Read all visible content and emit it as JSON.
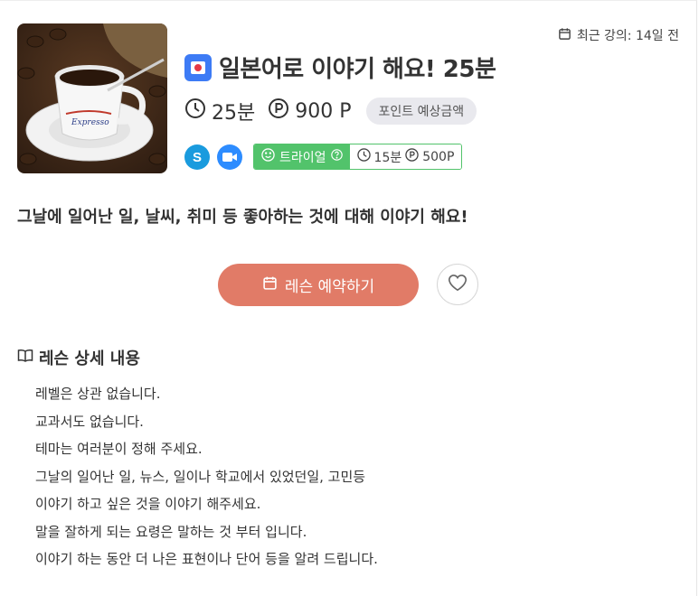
{
  "recent": {
    "label": "최근 강의: 14일 전"
  },
  "lesson": {
    "title": "일본어로 이야기 해요! 25분",
    "duration": "25분",
    "points": "900 P",
    "estimate_label": "포인트 예상금액"
  },
  "tools": [
    "skype-icon",
    "zoom-icon"
  ],
  "trial": {
    "label": "트라이얼",
    "duration": "15분",
    "points": "500P"
  },
  "summary": "그날에 일어난 일, 날씨, 취미 등 좋아하는 것에 대해 이야기 해요!",
  "actions": {
    "book_label": "레슨 예약하기"
  },
  "detail": {
    "title": "레슨 상세 내용",
    "lines": [
      "레벨은 상관 없습니다.",
      "교과서도 없습니다.",
      "테마는 여러분이 정해 주세요.",
      "그날의 일어난 일, 뉴스, 일이나 학교에서 있었던일, 고민등",
      "이야기 하고 싶은 것을 이야기 해주세요.",
      "말을 잘하게 되는 요령은 말하는 것 부터 입니다.",
      "이야기 하는 동안 더 나은 표현이나 단어 등을 알려 드립니다."
    ]
  },
  "colors": {
    "accent": "#e17b67",
    "trial": "#52c36b",
    "brand_blue": "#3d7bf5",
    "skype": "#1a9bde",
    "zoom": "#2d8cff"
  }
}
